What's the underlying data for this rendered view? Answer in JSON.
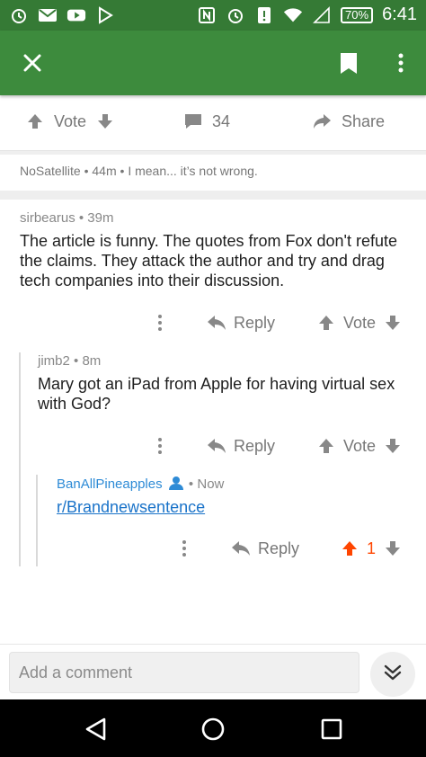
{
  "status_bar": {
    "battery": "70%",
    "time": "6:41"
  },
  "toolbar": {
    "close_icon": "close-icon",
    "bookmark_icon": "bookmark-icon",
    "more_icon": "more-vertical-icon"
  },
  "post_actions": {
    "vote_label": "Vote",
    "comment_count": "34",
    "share_label": "Share"
  },
  "context": {
    "author": "NoSatellite",
    "age": "44m",
    "snippet": "I mean... it’s not wrong."
  },
  "comments": [
    {
      "author": "sirbearus",
      "age": "39m",
      "body": "The article is funny. The quotes from Fox don't refute the claims. They attack the author and try and drag tech companies into their discussion.",
      "reply_label": "Reply",
      "vote_label": "Vote"
    },
    {
      "author": "jimb2",
      "age": "8m",
      "body": "Mary got an iPad from Apple for having virtual sex with God?",
      "reply_label": "Reply",
      "vote_label": "Vote"
    },
    {
      "author": "BanAllPineapples",
      "age": "Now",
      "link": "r/Brandnewsentence",
      "reply_label": "Reply",
      "score": "1"
    }
  ],
  "composer": {
    "placeholder": "Add a comment"
  },
  "colors": {
    "toolbar": "#3d8b3d",
    "statusbar": "#357a35",
    "upvoted": "#ff4500",
    "link": "#1a73c9"
  }
}
